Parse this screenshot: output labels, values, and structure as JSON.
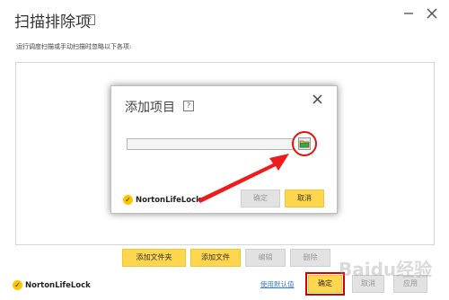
{
  "main": {
    "title": "扫描排除项",
    "help": "?",
    "description": "运行调度扫描或手动扫描时忽略以下各项:",
    "buttons": {
      "add_folder": "添加文件夹",
      "add_file": "添加文件",
      "edit": "编辑",
      "delete": "删除"
    },
    "footer": {
      "logo": "NortonLifeLock",
      "use_defaults": "使用默认值",
      "ok": "确定",
      "cancel": "取消",
      "apply": "应用"
    }
  },
  "sub_dialog": {
    "title": "添加项目",
    "help": "?",
    "close": "×",
    "path_value": "",
    "logo": "NortonLifeLock",
    "ok": "确定",
    "cancel": "取消"
  },
  "icons": {
    "minimize": "minimize-icon",
    "close": "close-icon",
    "browse": "folder-icon",
    "brand_check": "check-badge-icon"
  },
  "colors": {
    "accent_yellow": "#ffd64d",
    "highlight_red": "#e8120c",
    "link_blue": "#3a7bd5"
  },
  "watermark": "Baidu经验"
}
